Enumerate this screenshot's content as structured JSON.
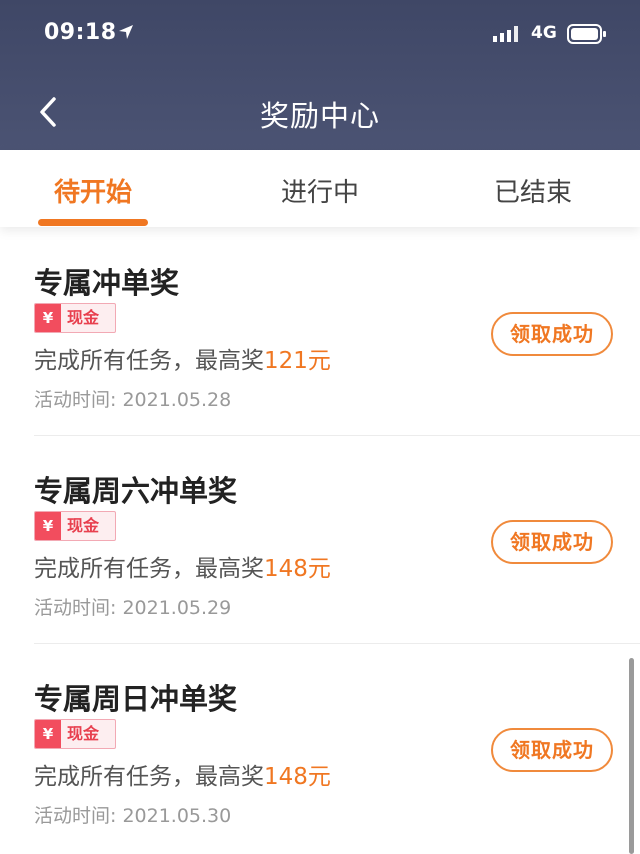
{
  "status_bar": {
    "time": "09:18",
    "network": "4G"
  },
  "nav": {
    "title": "奖励中心"
  },
  "tabs": [
    {
      "label": "待开始",
      "active": true
    },
    {
      "label": "进行中",
      "active": false
    },
    {
      "label": "已结束",
      "active": false
    }
  ],
  "rewards": [
    {
      "title": "专属冲单奖",
      "badge_symbol": "¥",
      "badge_label": "现金",
      "desc_prefix": "完成所有任务，最高奖",
      "amount": "121元",
      "date": "活动时间: 2021.05.28",
      "button": "领取成功"
    },
    {
      "title": "专属周六冲单奖",
      "badge_symbol": "¥",
      "badge_label": "现金",
      "desc_prefix": "完成所有任务，最高奖",
      "amount": "148元",
      "date": "活动时间: 2021.05.29",
      "button": "领取成功"
    },
    {
      "title": "专属周日冲单奖",
      "badge_symbol": "¥",
      "badge_label": "现金",
      "desc_prefix": "完成所有任务，最高奖",
      "amount": "148元",
      "date": "活动时间: 2021.05.30",
      "button": "领取成功"
    }
  ],
  "icons": {
    "location": "location-arrow-icon",
    "signal": "signal-bars-icon",
    "battery": "battery-icon",
    "back": "chevron-left-icon"
  },
  "colors": {
    "accent": "#f07722",
    "header_bg": "#434b6b",
    "badge_red": "#f24d5e"
  }
}
